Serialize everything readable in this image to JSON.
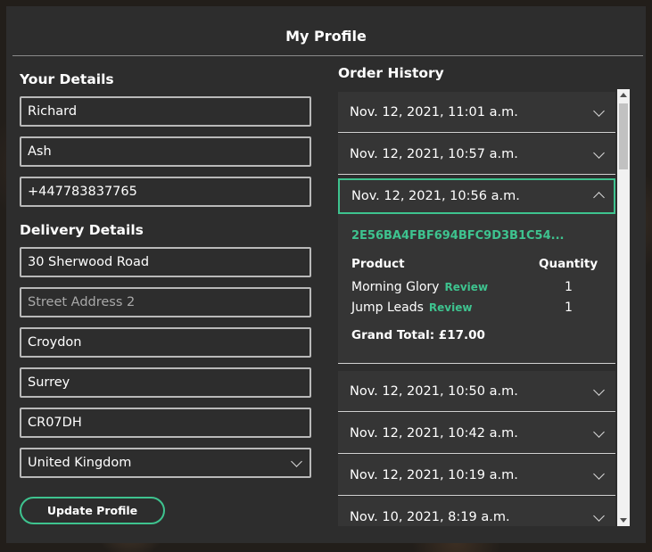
{
  "page": {
    "title": "My Profile"
  },
  "details": {
    "heading": "Your Details",
    "first_name": "Richard",
    "last_name": "Ash",
    "phone": "+447783837765"
  },
  "delivery": {
    "heading": "Delivery Details",
    "street1": "30 Sherwood Road",
    "street2_placeholder": "Street Address 2",
    "town": "Croydon",
    "county": "Surrey",
    "postcode": "CR07DH",
    "country": "United Kingdom"
  },
  "actions": {
    "update_label": "Update Profile"
  },
  "history": {
    "heading": "Order History",
    "orders": [
      {
        "date": "Nov. 12, 2021, 11:01 a.m."
      },
      {
        "date": "Nov. 12, 2021, 10:57 a.m."
      },
      {
        "date": "Nov. 12, 2021, 10:56 a.m."
      },
      {
        "date": "Nov. 12, 2021, 10:50 a.m."
      },
      {
        "date": "Nov. 12, 2021, 10:42 a.m."
      },
      {
        "date": "Nov. 12, 2021, 10:19 a.m."
      },
      {
        "date": "Nov. 10, 2021, 8:19 a.m."
      }
    ],
    "open_order": {
      "order_number": "2E56BA4FBF694BFC9D3B1C54...",
      "product_header": "Product",
      "quantity_header": "Quantity",
      "items": [
        {
          "name": "Morning Glory",
          "review": "Review",
          "qty": "1"
        },
        {
          "name": "Jump Leads",
          "review": "Review",
          "qty": "1"
        }
      ],
      "total": "Grand Total: £17.00"
    }
  },
  "colors": {
    "accent": "#3ec38f",
    "card": "#2d2d2d",
    "row": "#353535"
  }
}
